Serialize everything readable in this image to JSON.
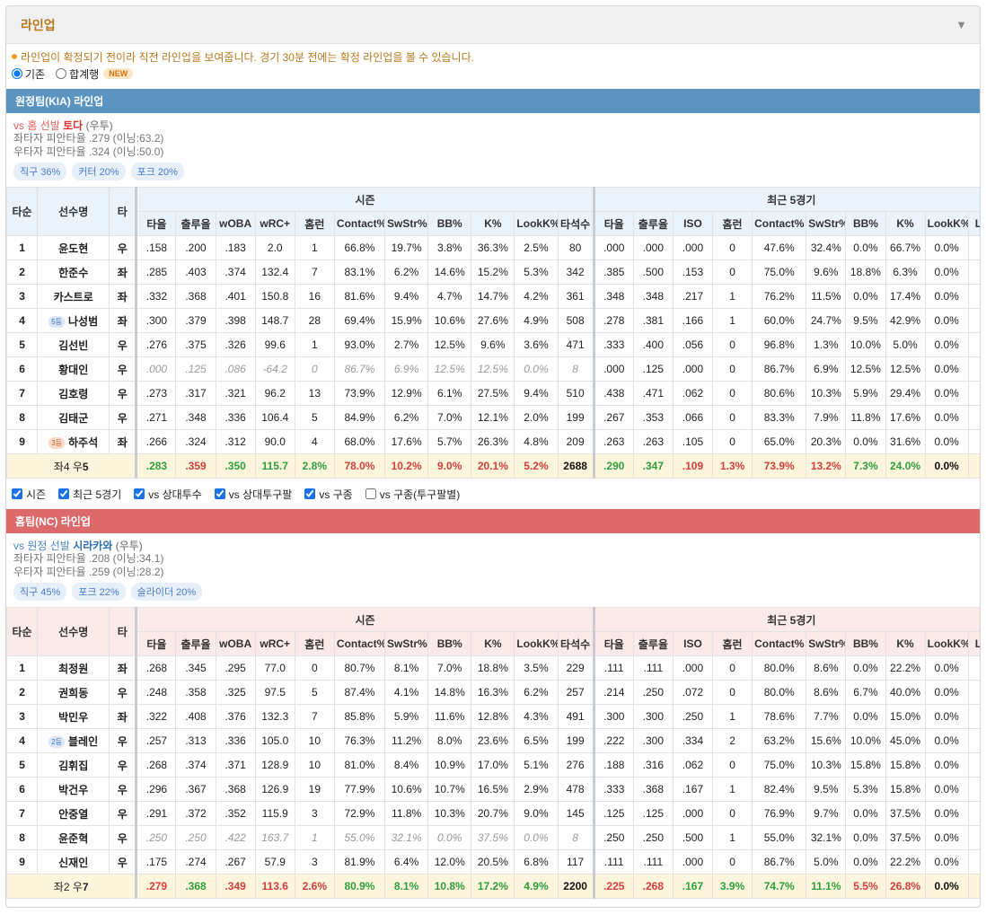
{
  "panel": {
    "title": "라인업"
  },
  "notice": "라인업이 확정되기 전이라 직전 라인업을 보여줍니다. 경기 30분 전에는 확정 라인업을 볼 수 있습니다.",
  "view_options": {
    "basic": "기존",
    "combined": "합계행",
    "new_badge": "NEW"
  },
  "headers": {
    "order": "타순",
    "name": "선수명",
    "hand": "타",
    "season": "시즌",
    "recent": "최근 5경기",
    "season_cols": [
      "타율",
      "출루율",
      "wOBA",
      "wRC+",
      "홈런",
      "Contact%",
      "SwStr%",
      "BB%",
      "K%",
      "LookK%",
      "타석수"
    ],
    "recent_cols": [
      "타율",
      "출루율",
      "ISO",
      "홈런",
      "Contact%",
      "SwStr%",
      "BB%",
      "K%",
      "LookK%",
      "L"
    ]
  },
  "away": {
    "title": "원정팀(KIA) 라인업",
    "vs_prefix": "vs 홈 선발",
    "pitcher": "토다",
    "pitcher_hand": "(우투)",
    "lhb": "좌타자 피안타율 .279 (이닝:63.2)",
    "rhb": "우타자 피안타율 .324 (이닝:50.0)",
    "tags": [
      "직구 36%",
      "커터 20%",
      "포크 20%"
    ],
    "rows": [
      {
        "no": "1",
        "name": "윤도현",
        "badge": "",
        "hand": "우",
        "muted": false,
        "s": [
          ".158",
          ".200",
          ".183",
          "2.0",
          "1",
          "66.8%",
          "19.7%",
          "3.8%",
          "36.3%",
          "2.5%",
          "80"
        ],
        "r": [
          ".000",
          ".000",
          ".000",
          "0",
          "47.6%",
          "32.4%",
          "0.0%",
          "66.7%",
          "0.0%"
        ]
      },
      {
        "no": "2",
        "name": "한준수",
        "badge": "",
        "hand": "좌",
        "muted": false,
        "s": [
          ".285",
          ".403",
          ".374",
          "132.4",
          "7",
          "83.1%",
          "6.2%",
          "14.6%",
          "15.2%",
          "5.3%",
          "342"
        ],
        "r": [
          ".385",
          ".500",
          ".153",
          "0",
          "75.0%",
          "9.6%",
          "18.8%",
          "6.3%",
          "0.0%"
        ]
      },
      {
        "no": "3",
        "name": "카스트로",
        "badge": "",
        "hand": "좌",
        "muted": false,
        "s": [
          ".332",
          ".368",
          ".401",
          "150.8",
          "16",
          "81.6%",
          "9.4%",
          "4.7%",
          "14.7%",
          "4.2%",
          "361"
        ],
        "r": [
          ".348",
          ".348",
          ".217",
          "1",
          "76.2%",
          "11.5%",
          "0.0%",
          "17.4%",
          "0.0%"
        ]
      },
      {
        "no": "4",
        "name": "나성범",
        "badge": "5등",
        "badgeColor": "blue",
        "hand": "좌",
        "muted": false,
        "s": [
          ".300",
          ".379",
          ".398",
          "148.7",
          "28",
          "69.4%",
          "15.9%",
          "10.6%",
          "27.6%",
          "4.9%",
          "508"
        ],
        "r": [
          ".278",
          ".381",
          ".166",
          "1",
          "60.0%",
          "24.7%",
          "9.5%",
          "42.9%",
          "0.0%"
        ]
      },
      {
        "no": "5",
        "name": "김선빈",
        "badge": "",
        "hand": "우",
        "muted": false,
        "s": [
          ".276",
          ".375",
          ".326",
          "99.6",
          "1",
          "93.0%",
          "2.7%",
          "12.5%",
          "9.6%",
          "3.6%",
          "471"
        ],
        "r": [
          ".333",
          ".400",
          ".056",
          "0",
          "96.8%",
          "1.3%",
          "10.0%",
          "5.0%",
          "0.0%"
        ]
      },
      {
        "no": "6",
        "name": "황대인",
        "badge": "",
        "hand": "우",
        "muted": true,
        "s": [
          ".000",
          ".125",
          ".086",
          "-64.2",
          "0",
          "86.7%",
          "6.9%",
          "12.5%",
          "12.5%",
          "0.0%",
          "8"
        ],
        "r": [
          ".000",
          ".125",
          ".000",
          "0",
          "86.7%",
          "6.9%",
          "12.5%",
          "12.5%",
          "0.0%"
        ]
      },
      {
        "no": "7",
        "name": "김호령",
        "badge": "",
        "hand": "우",
        "muted": false,
        "s": [
          ".273",
          ".317",
          ".321",
          "96.2",
          "13",
          "73.9%",
          "12.9%",
          "6.1%",
          "27.5%",
          "9.4%",
          "510"
        ],
        "r": [
          ".438",
          ".471",
          ".062",
          "0",
          "80.6%",
          "10.3%",
          "5.9%",
          "29.4%",
          "0.0%"
        ]
      },
      {
        "no": "8",
        "name": "김태군",
        "badge": "",
        "hand": "우",
        "muted": false,
        "s": [
          ".271",
          ".348",
          ".336",
          "106.4",
          "5",
          "84.9%",
          "6.2%",
          "7.0%",
          "12.1%",
          "2.0%",
          "199"
        ],
        "r": [
          ".267",
          ".353",
          ".066",
          "0",
          "83.3%",
          "7.9%",
          "11.8%",
          "17.6%",
          "0.0%"
        ]
      },
      {
        "no": "9",
        "name": "하주석",
        "badge": "3등",
        "badgeColor": "orange",
        "hand": "좌",
        "muted": false,
        "s": [
          ".266",
          ".324",
          ".312",
          "90.0",
          "4",
          "68.0%",
          "17.6%",
          "5.7%",
          "26.3%",
          "4.8%",
          "209"
        ],
        "r": [
          ".263",
          ".263",
          ".105",
          "0",
          "65.0%",
          "20.3%",
          "0.0%",
          "31.6%",
          "0.0%"
        ]
      }
    ],
    "summary": {
      "label_a": "좌4 우",
      "label_b": "5",
      "s": [
        ".283",
        ".359",
        ".350",
        "115.7",
        "2.8%",
        "78.0%",
        "10.2%",
        "9.0%",
        "20.1%",
        "5.2%",
        "2688"
      ],
      "s_color": [
        "g",
        "r",
        "g",
        "g",
        "g",
        "r",
        "r",
        "r",
        "r",
        "r",
        "k"
      ],
      "r": [
        ".290",
        ".347",
        ".109",
        "1.3%",
        "73.9%",
        "13.2%",
        "7.3%",
        "24.0%",
        "0.0%"
      ],
      "r_color": [
        "g",
        "g",
        "r",
        "r",
        "r",
        "r",
        "g",
        "g",
        "k"
      ]
    }
  },
  "filters": [
    "시즌",
    "최근 5경기",
    "vs 상대투수",
    "vs 상대투구팔",
    "vs 구종",
    "vs 구종(투구팔별)"
  ],
  "home": {
    "title": "홈팀(NC) 라인업",
    "vs_prefix": "vs 원정 선발",
    "pitcher": "시라카와",
    "pitcher_hand": "(우투)",
    "lhb": "좌타자 피안타율 .208 (이닝:34.1)",
    "rhb": "우타자 피안타율 .259 (이닝:28.2)",
    "tags": [
      "직구 45%",
      "포크 22%",
      "슬라이더 20%"
    ],
    "rows": [
      {
        "no": "1",
        "name": "최정원",
        "badge": "",
        "hand": "좌",
        "muted": false,
        "s": [
          ".268",
          ".345",
          ".295",
          "77.0",
          "0",
          "80.7%",
          "8.1%",
          "7.0%",
          "18.8%",
          "3.5%",
          "229"
        ],
        "r": [
          ".111",
          ".111",
          ".000",
          "0",
          "80.0%",
          "8.6%",
          "0.0%",
          "22.2%",
          "0.0%"
        ]
      },
      {
        "no": "2",
        "name": "권희동",
        "badge": "",
        "hand": "우",
        "muted": false,
        "s": [
          ".248",
          ".358",
          ".325",
          "97.5",
          "5",
          "87.4%",
          "4.1%",
          "14.8%",
          "16.3%",
          "6.2%",
          "257"
        ],
        "r": [
          ".214",
          ".250",
          ".072",
          "0",
          "80.0%",
          "8.6%",
          "6.7%",
          "40.0%",
          "0.0%"
        ]
      },
      {
        "no": "3",
        "name": "박민우",
        "badge": "",
        "hand": "좌",
        "muted": false,
        "s": [
          ".322",
          ".408",
          ".376",
          "132.3",
          "7",
          "85.8%",
          "5.9%",
          "11.6%",
          "12.8%",
          "4.3%",
          "491"
        ],
        "r": [
          ".300",
          ".300",
          ".250",
          "1",
          "78.6%",
          "7.7%",
          "0.0%",
          "15.0%",
          "0.0%"
        ]
      },
      {
        "no": "4",
        "name": "블레인",
        "badge": "2등",
        "badgeColor": "blue",
        "hand": "우",
        "muted": false,
        "s": [
          ".257",
          ".313",
          ".336",
          "105.0",
          "10",
          "76.3%",
          "11.2%",
          "8.0%",
          "23.6%",
          "6.5%",
          "199"
        ],
        "r": [
          ".222",
          ".300",
          ".334",
          "2",
          "63.2%",
          "15.6%",
          "10.0%",
          "45.0%",
          "0.0%"
        ]
      },
      {
        "no": "5",
        "name": "김휘집",
        "badge": "",
        "hand": "우",
        "muted": false,
        "s": [
          ".268",
          ".374",
          ".371",
          "128.9",
          "10",
          "81.0%",
          "8.4%",
          "10.9%",
          "17.0%",
          "5.1%",
          "276"
        ],
        "r": [
          ".188",
          ".316",
          ".062",
          "0",
          "75.0%",
          "10.3%",
          "15.8%",
          "15.8%",
          "0.0%"
        ]
      },
      {
        "no": "6",
        "name": "박건우",
        "badge": "",
        "hand": "우",
        "muted": false,
        "s": [
          ".296",
          ".367",
          ".368",
          "126.9",
          "19",
          "77.9%",
          "10.6%",
          "10.7%",
          "16.5%",
          "2.9%",
          "478"
        ],
        "r": [
          ".333",
          ".368",
          ".167",
          "1",
          "82.4%",
          "9.5%",
          "5.3%",
          "15.8%",
          "0.0%"
        ]
      },
      {
        "no": "7",
        "name": "안중열",
        "badge": "",
        "hand": "우",
        "muted": false,
        "s": [
          ".291",
          ".372",
          ".352",
          "115.9",
          "3",
          "72.9%",
          "11.8%",
          "10.3%",
          "20.7%",
          "9.0%",
          "145"
        ],
        "r": [
          ".125",
          ".125",
          ".000",
          "0",
          "76.9%",
          "9.7%",
          "0.0%",
          "37.5%",
          "0.0%"
        ]
      },
      {
        "no": "8",
        "name": "윤준혁",
        "badge": "",
        "hand": "우",
        "muted": true,
        "s": [
          ".250",
          ".250",
          ".422",
          "163.7",
          "1",
          "55.0%",
          "32.1%",
          "0.0%",
          "37.5%",
          "0.0%",
          "8"
        ],
        "r": [
          ".250",
          ".250",
          ".500",
          "1",
          "55.0%",
          "32.1%",
          "0.0%",
          "37.5%",
          "0.0%"
        ]
      },
      {
        "no": "9",
        "name": "신재인",
        "badge": "",
        "hand": "우",
        "muted": false,
        "s": [
          ".175",
          ".274",
          ".267",
          "57.9",
          "3",
          "81.9%",
          "6.4%",
          "12.0%",
          "20.5%",
          "6.8%",
          "117"
        ],
        "r": [
          ".111",
          ".111",
          ".000",
          "0",
          "86.7%",
          "5.0%",
          "0.0%",
          "22.2%",
          "0.0%"
        ]
      }
    ],
    "summary": {
      "label_a": "좌2 우",
      "label_b": "7",
      "s": [
        ".279",
        ".368",
        ".349",
        "113.6",
        "2.6%",
        "80.9%",
        "8.1%",
        "10.8%",
        "17.2%",
        "4.9%",
        "2200"
      ],
      "s_color": [
        "r",
        "g",
        "r",
        "r",
        "r",
        "g",
        "g",
        "g",
        "g",
        "g",
        "k"
      ],
      "r": [
        ".225",
        ".268",
        ".167",
        "3.9%",
        "74.7%",
        "11.1%",
        "5.5%",
        "26.8%",
        "0.0%"
      ],
      "r_color": [
        "r",
        "r",
        "g",
        "g",
        "g",
        "g",
        "r",
        "r",
        "k"
      ]
    }
  }
}
